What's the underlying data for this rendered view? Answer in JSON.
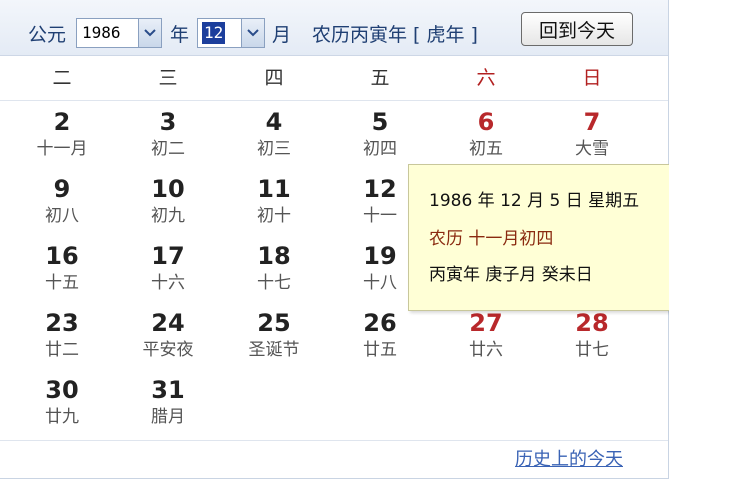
{
  "header": {
    "era_label": "公元",
    "year_value": "1986",
    "year_label": "年",
    "month_value": "12",
    "month_label": "月",
    "lunar_year": "农历丙寅年 [ 虎年 ]",
    "today_button": "回到今天"
  },
  "weekdays": [
    "二",
    "三",
    "四",
    "五",
    "六",
    "日"
  ],
  "weeks": [
    [
      {
        "day": "2",
        "lunar": "十一月"
      },
      {
        "day": "3",
        "lunar": "初二"
      },
      {
        "day": "4",
        "lunar": "初三"
      },
      {
        "day": "5",
        "lunar": "初四"
      },
      {
        "day": "6",
        "lunar": "初五"
      },
      {
        "day": "7",
        "lunar": "大雪"
      }
    ],
    [
      {
        "day": "9",
        "lunar": "初八"
      },
      {
        "day": "10",
        "lunar": "初九"
      },
      {
        "day": "11",
        "lunar": "初十"
      },
      {
        "day": "12",
        "lunar": "十一"
      }
    ],
    [
      {
        "day": "16",
        "lunar": "十五"
      },
      {
        "day": "17",
        "lunar": "十六"
      },
      {
        "day": "18",
        "lunar": "十七"
      },
      {
        "day": "19",
        "lunar": "十八"
      }
    ],
    [
      {
        "day": "23",
        "lunar": "廿二"
      },
      {
        "day": "24",
        "lunar": "平安夜"
      },
      {
        "day": "25",
        "lunar": "圣诞节"
      },
      {
        "day": "26",
        "lunar": "廿五"
      },
      {
        "day": "27",
        "lunar": "廿六"
      },
      {
        "day": "28",
        "lunar": "廿七"
      }
    ],
    [
      {
        "day": "30",
        "lunar": "廿九"
      },
      {
        "day": "31",
        "lunar": "腊月"
      }
    ]
  ],
  "tooltip": {
    "date_line": "1986 年 12 月 5 日 星期五",
    "lunar_line": "农历 十一月初四",
    "ganzhi_line": "丙寅年 庚子月 癸未日"
  },
  "footer": {
    "history_link": "历史上的今天"
  },
  "colors": {
    "weekend_red": "#b8282b",
    "header_text": "#1f3f73",
    "tooltip_bg": "#ffffd6",
    "link": "#3a63b5"
  }
}
